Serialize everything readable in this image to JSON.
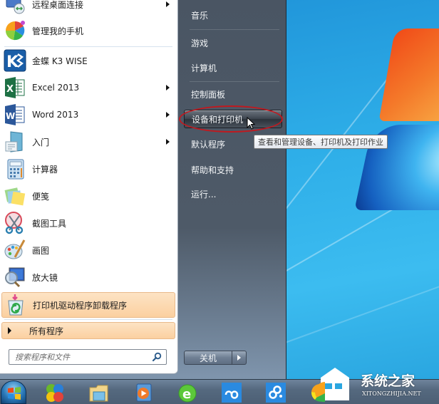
{
  "start_menu": {
    "programs": [
      {
        "label": "远程桌面连接",
        "icon": "remote-desktop-icon",
        "has_submenu": true
      },
      {
        "label": "管理我的手机",
        "icon": "phone-manager-icon",
        "has_submenu": false
      },
      {
        "label": "金蝶 K3 WISE",
        "icon": "kingdee-k3-icon",
        "has_submenu": false
      },
      {
        "label": "Excel 2013",
        "icon": "excel-icon",
        "has_submenu": true
      },
      {
        "label": "Word 2013",
        "icon": "word-icon",
        "has_submenu": true
      },
      {
        "label": "入门",
        "icon": "getting-started-icon",
        "has_submenu": true
      },
      {
        "label": "计算器",
        "icon": "calculator-icon",
        "has_submenu": false
      },
      {
        "label": "便笺",
        "icon": "sticky-notes-icon",
        "has_submenu": false
      },
      {
        "label": "截图工具",
        "icon": "snipping-tool-icon",
        "has_submenu": false
      },
      {
        "label": "画图",
        "icon": "paint-icon",
        "has_submenu": false
      },
      {
        "label": "放大镜",
        "icon": "magnifier-icon",
        "has_submenu": false
      },
      {
        "label": "打印机驱动程序卸载程序",
        "icon": "printer-driver-uninstaller-icon",
        "has_submenu": false,
        "highlighted": true
      }
    ],
    "all_programs_label": "所有程序",
    "search": {
      "placeholder": "搜索程序和文件",
      "value": ""
    },
    "right_items": [
      {
        "label": "音乐"
      },
      {
        "label": "游戏"
      },
      {
        "label": "计算机"
      },
      {
        "label": "控制面板"
      },
      {
        "label": "设备和打印机",
        "hovered": true
      },
      {
        "label": "默认程序"
      },
      {
        "label": "帮助和支持"
      },
      {
        "label": "运行..."
      }
    ],
    "tooltip": "查看和管理设备、打印机及打印作业",
    "shutdown_label": "关机"
  },
  "taskbar": {
    "items": [
      {
        "name": "start-button"
      },
      {
        "name": "app-360-icon"
      },
      {
        "name": "file-explorer-icon"
      },
      {
        "name": "media-player-icon"
      },
      {
        "name": "ie-browser-icon"
      },
      {
        "name": "cloud-sync-icon"
      },
      {
        "name": "baidu-cloud-icon"
      },
      {
        "name": "colorful-app-icon"
      }
    ]
  },
  "watermark": {
    "title": "系统之家",
    "subtitle": "XITONGZHIJIA.NET"
  },
  "colors": {
    "annotation_ring": "#c0191f",
    "highlight_bg": "#fbd0a0",
    "right_pane_bg": "#4e5a68"
  }
}
